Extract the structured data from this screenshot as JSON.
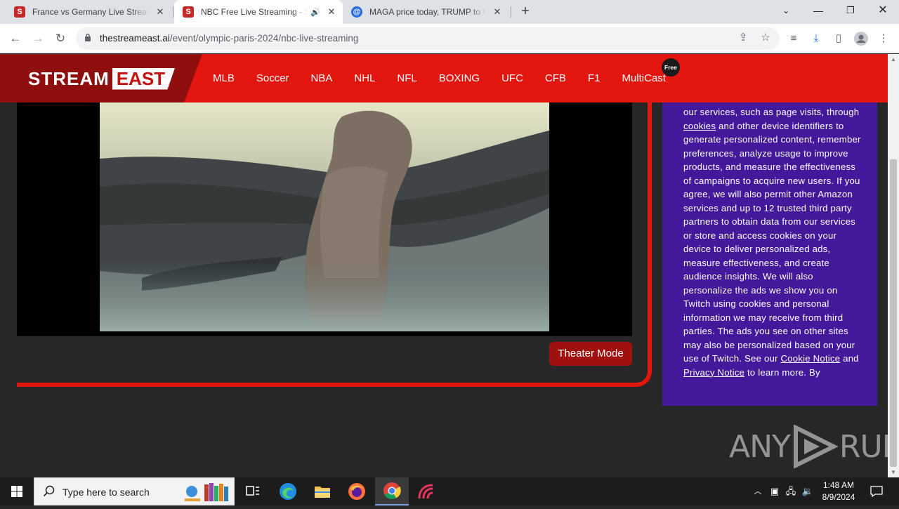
{
  "browser": {
    "tabs": [
      {
        "title": "France vs Germany Live Streaming",
        "favicon": "S",
        "favicon_color": "#c62828",
        "active": false
      },
      {
        "title": "NBC Free Live Streaming - StreamEast",
        "favicon": "S",
        "favicon_color": "#c62828",
        "active": true
      },
      {
        "title": "MAGA price today, TRUMP to USD",
        "favicon": "@",
        "favicon_color": "#2d6cdf",
        "active": false
      }
    ],
    "url_host": "thestreameast.ai",
    "url_path": "/event/olympic-paris-2024/nbc-live-streaming"
  },
  "site": {
    "logo_stream": "STREAM",
    "logo_east": "EAST",
    "nav": [
      "MLB",
      "Soccer",
      "NBA",
      "NHL",
      "NFL",
      "BOXING",
      "UFC",
      "CFB",
      "F1",
      "MultiCast"
    ],
    "free_badge": "Free",
    "brand_red": "#e3150f",
    "theater_mode": "Theater Mode"
  },
  "consent": {
    "text_1": "our services, such as page visits, through ",
    "link_cookies": "cookies",
    "text_2": " and other device identifiers to generate personalized content, remember preferences, analyze usage to improve products, and measure the effectiveness of campaigns to acquire new users. If you agree, we will also permit other Amazon services and up to 12 trusted third party partners to obtain data from our services or store and access cookies on your device to deliver personalized ads, measure effectiveness, and create audience insights. We will also personalize the ads we show you on Twitch using cookies and personal information we may receive from third parties. The ads you see on other sites may also be personalized based on your use of Twitch. See our ",
    "link_cookie_notice": "Cookie Notice",
    "text_3": " and ",
    "link_privacy": "Privacy Notice",
    "text_4": " to learn more. By",
    "bg_color": "#43189a"
  },
  "watermark": {
    "left": "ANY",
    "right": "RUN"
  },
  "taskbar": {
    "search_placeholder": "Type here to search",
    "time": "1:48 AM",
    "date": "8/9/2024"
  }
}
